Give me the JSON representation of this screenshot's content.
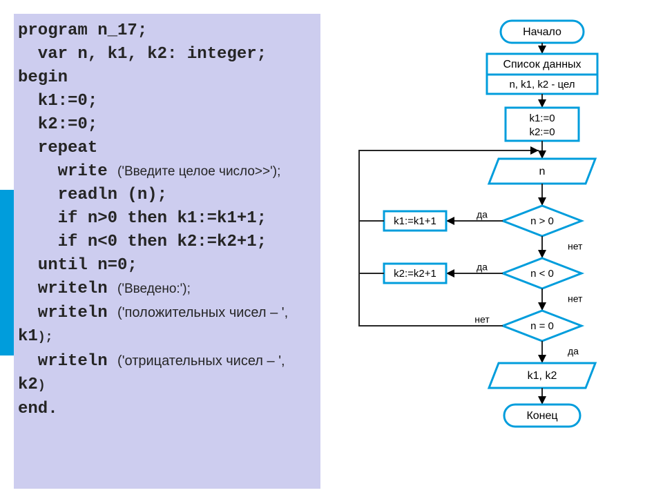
{
  "code": {
    "l1": "program n_17;",
    "l2": "  var n, k1, k2: integer;",
    "l3": "begin",
    "l4": "  k1:=0;",
    "l5": "  k2:=0;",
    "l6": "  repeat",
    "l7a": "    write ",
    "l7b": "('Введите целое число>>');",
    "l8": "    readln (n);",
    "l9": "    if n>0 then k1:=k1+1;",
    "l10": "    if n<0 then k2:=k2+1;",
    "l11": "  until n=0;",
    "l12a": "  writeln ",
    "l12b": "('Введено:');",
    "l13a": "  writeln ",
    "l13b": "('положительных чисел – ',",
    "l14": "k1",
    "l14b": ");",
    "l15a": "  writeln ",
    "l15b": "('отрицательных чисел – ',",
    "l16": "k2",
    "l16b": ")",
    "l17": "end."
  },
  "flowchart": {
    "start": "Начало",
    "data_title": "Список данных",
    "data_vars": "n, k1, k2 - цел",
    "init_line1": "k1:=0",
    "init_line2": "k2:=0",
    "input_n": "n",
    "cond1": "n > 0",
    "cond2": "n < 0",
    "cond3": "n = 0",
    "act1": "k1:=k1+1",
    "act2": "k2:=k2+1",
    "output": "k1, k2",
    "end": "Конец",
    "yes": "да",
    "no": "нет"
  }
}
